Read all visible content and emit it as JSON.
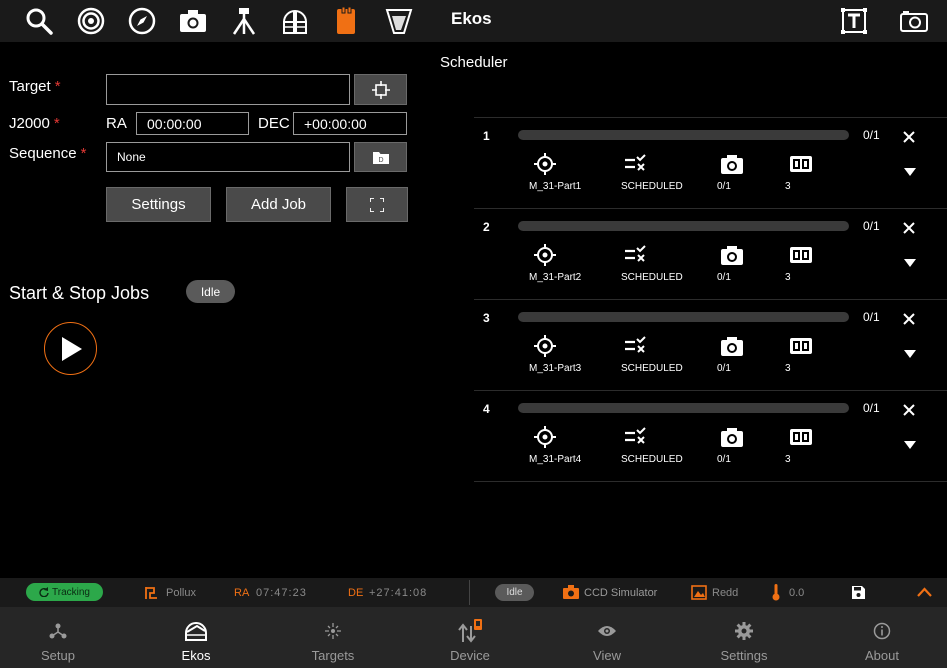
{
  "app_title": "Ekos",
  "form": {
    "target_label": "Target",
    "target_value": "",
    "j2000_label": "J2000",
    "ra_label": "RA",
    "ra_value": "00:00:00",
    "dec_label": "DEC",
    "dec_value": "+00:00:00",
    "sequence_label": "Sequence",
    "sequence_value": "None",
    "required_marker": "*",
    "settings_label": "Settings",
    "add_job_label": "Add Job"
  },
  "control": {
    "title": "Start & Stop Jobs",
    "status": "Idle"
  },
  "scheduler": {
    "title": "Scheduler",
    "jobs": [
      {
        "num": "1",
        "progress": "0/1",
        "name": "M_31-Part1",
        "state": "SCHEDULED",
        "captures": "0/1",
        "count": "3"
      },
      {
        "num": "2",
        "progress": "0/1",
        "name": "M_31-Part2",
        "state": "SCHEDULED",
        "captures": "0/1",
        "count": "3"
      },
      {
        "num": "3",
        "progress": "0/1",
        "name": "M_31-Part3",
        "state": "SCHEDULED",
        "captures": "0/1",
        "count": "3"
      },
      {
        "num": "4",
        "progress": "0/1",
        "name": "M_31-Part4",
        "state": "SCHEDULED",
        "captures": "0/1",
        "count": "3"
      }
    ]
  },
  "statusbar": {
    "tracking": "Tracking",
    "target": "Pollux",
    "ra_label": "RA",
    "ra_value": "07:47:23",
    "de_label": "DE",
    "de_value": "+27:41:08",
    "idle": "Idle",
    "camera": "CCD Simulator",
    "filter": "Redd",
    "temperature": "0.0"
  },
  "nav": [
    {
      "label": "Setup"
    },
    {
      "label": "Ekos"
    },
    {
      "label": "Targets"
    },
    {
      "label": "Device"
    },
    {
      "label": "View"
    },
    {
      "label": "Settings"
    },
    {
      "label": "About"
    }
  ],
  "colors": {
    "accent": "#f07014",
    "required": "#e53935",
    "tracking": "#2ca84a"
  }
}
